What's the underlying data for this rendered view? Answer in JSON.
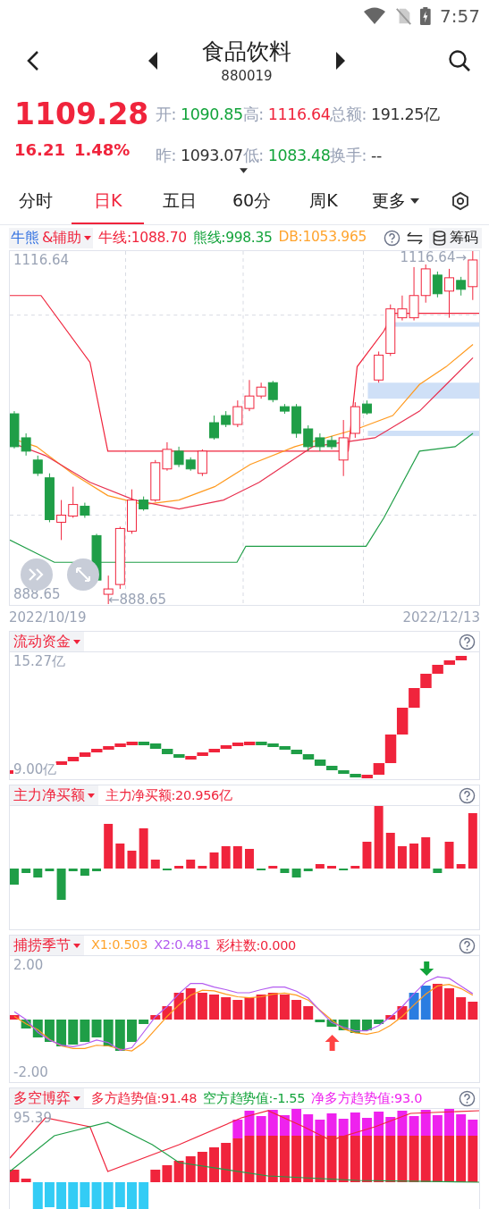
{
  "status_bar": {
    "time": "7:57"
  },
  "header": {
    "title": "食品饮料",
    "code": "880019"
  },
  "quote": {
    "price": "1109.28",
    "change": "16.21",
    "change_pct": "1.48%",
    "rows": [
      [
        {
          "label": "开:",
          "value": "1090.85",
          "color": "#12a33a"
        },
        {
          "label": "高:",
          "value": "1116.64",
          "color": "#f0243c"
        },
        {
          "label": "总额:",
          "value": "191.25亿",
          "color": "#333333"
        }
      ],
      [
        {
          "label": "昨:",
          "value": "1093.07",
          "color": "#333333"
        },
        {
          "label": "低:",
          "value": "1083.48",
          "color": "#12a33a"
        },
        {
          "label": "换手:",
          "value": "--",
          "color": "#333333"
        }
      ]
    ]
  },
  "tabs": [
    {
      "label": "分时",
      "selected": false,
      "kind": "text"
    },
    {
      "label": "日K",
      "selected": true,
      "kind": "text"
    },
    {
      "label": "五日",
      "selected": false,
      "kind": "text"
    },
    {
      "label": "60分",
      "selected": false,
      "kind": "text"
    },
    {
      "label": "周K",
      "selected": false,
      "kind": "text"
    },
    {
      "label": "更多",
      "selected": false,
      "kind": "menu"
    }
  ],
  "main_chart": {
    "title_parts": [
      {
        "text": "牛熊",
        "color": "#2f6fe0"
      },
      {
        "text": "&辅助",
        "color": "#f0243c"
      }
    ],
    "readings": [
      {
        "text": "牛线:1088.70",
        "color": "#f0243c"
      },
      {
        "text": "熊线:998.35",
        "color": "#12a33a"
      },
      {
        "text": "DB:1053.965",
        "color": "#ffa42e"
      }
    ],
    "tool_label": "筹码",
    "high_label": "1116.64",
    "low_label": "888.65",
    "high_marker": "1116.64→",
    "low_marker": "←888.65",
    "start_date": "2022/10/19",
    "end_date": "2022/12/13"
  },
  "panels": [
    {
      "kind": "flow",
      "title": "流动资金",
      "top_label": "15.27亿",
      "bottom_label": "9.00亿"
    },
    {
      "kind": "netbuy",
      "title": "主力净买额",
      "readings": [
        {
          "text": "主力净买额:20.956亿",
          "color": "#f0243c"
        }
      ]
    },
    {
      "kind": "season",
      "title": "捕捞季节",
      "readings": [
        {
          "text": "X1:0.503",
          "color": "#ffa42e"
        },
        {
          "text": "X2:0.481",
          "color": "#b45cf0"
        },
        {
          "text": "彩柱数:0.000",
          "color": "#f0243c"
        }
      ],
      "top_label": "2.00",
      "bottom_label": "-2.00"
    },
    {
      "kind": "longshort",
      "title": "多空博弈",
      "readings": [
        {
          "text": "多方趋势值:91.48",
          "color": "#f0243c"
        },
        {
          "text": "空方趋势值:-1.55",
          "color": "#12a33a"
        },
        {
          "text": "净多方趋势值:93.0",
          "color": "#ee22ee"
        }
      ],
      "top_label": "95.39"
    }
  ]
}
